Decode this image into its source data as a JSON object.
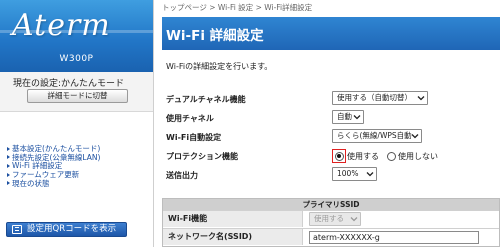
{
  "brand": {
    "logo_text": "Aterm",
    "model": "W300P"
  },
  "sidebar": {
    "current_mode": "現在の設定:かんたんモード",
    "mode_button": "詳細モードに切替",
    "nav_items": [
      {
        "label": "基本設定(かんたんモード)"
      },
      {
        "label": "接続先設定(公衆無線LAN)"
      },
      {
        "label": "Wi-Fi 詳細設定"
      },
      {
        "label": "ファームウェア更新"
      },
      {
        "label": "現在の状態"
      }
    ],
    "qr_button": "設定用QRコードを表示"
  },
  "header": {
    "breadcrumb": "トップページ > Wi-Fi 設定 > Wi-Fi詳細設定",
    "title": "Wi-Fi 詳細設定"
  },
  "main": {
    "description": "Wi-Fiの詳細設定を行います。",
    "dual_channel": {
      "label": "デュアルチャネル機能",
      "value": "使用する（自動切替）"
    },
    "channel": {
      "label": "使用チャネル",
      "value": "自動"
    },
    "wifi_auto_setup": {
      "label": "Wi-Fi自動設定",
      "value": "らくら(無線/WPS自動"
    },
    "protection": {
      "label": "プロテクション機能",
      "options": [
        {
          "label": "使用する",
          "selected": true
        },
        {
          "label": "使用しない",
          "selected": false
        }
      ]
    },
    "tx_power": {
      "label": "送信出力",
      "value": "100%"
    }
  },
  "ssid_table": {
    "header": "プライマリSSID",
    "wifi_function": {
      "label": "Wi-Fi機能",
      "value": "使用する"
    },
    "network_name": {
      "label": "ネットワーク名(SSID)",
      "value": "aterm-XXXXXX-g"
    }
  },
  "colors": {
    "header_blue": "#1f66b6",
    "link_blue": "#1b4fa0",
    "highlight_red": "#e02020"
  }
}
